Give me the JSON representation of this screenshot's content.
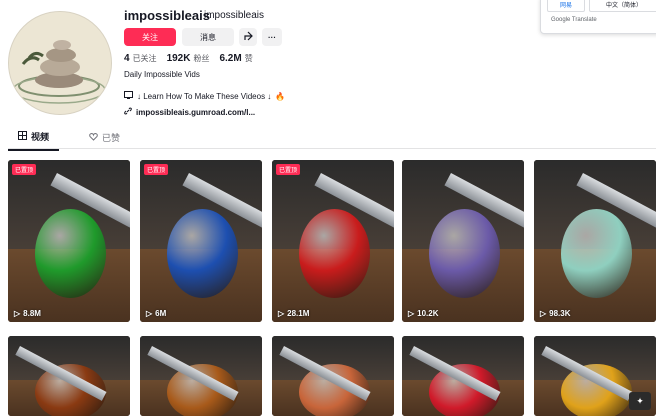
{
  "profile": {
    "username": "impossibleais",
    "nickname": "impossibleais",
    "follow_label": "关注",
    "message_label": "消息",
    "following_count": "4",
    "following_label": "已关注",
    "followers_count": "192K",
    "followers_label": "粉丝",
    "likes_count": "6.2M",
    "likes_label": "赞",
    "bio": "Daily Impossible Vids",
    "bio_line2": "↓ Learn How To Make These Videos ↓",
    "link": "impossibleais.gumroad.com/l..."
  },
  "tabs": [
    {
      "label": "视频",
      "icon": "grid-icon",
      "active": true
    },
    {
      "label": "已赞",
      "icon": "heart-outline-icon",
      "active": false
    }
  ],
  "videos": [
    {
      "views": "8.8M",
      "badge": "已置顶",
      "subject": "green jelly",
      "color": "#1f9a2b"
    },
    {
      "views": "6M",
      "badge": "已置顶",
      "subject": "blue berry",
      "color": "#1d4fb0"
    },
    {
      "views": "28.1M",
      "badge": "已置顶",
      "subject": "glass strawberry",
      "color": "#c91c1c"
    },
    {
      "views": "10.2K",
      "badge": "",
      "subject": "glass orb",
      "color": "#6b5aa8"
    },
    {
      "views": "98.3K",
      "badge": "",
      "subject": "glass sphere",
      "color": "#8fcfbf"
    },
    {
      "views": "",
      "badge": "",
      "subject": "glazed dessert",
      "color": "#8a3a12"
    },
    {
      "views": "",
      "badge": "",
      "subject": "glass burger",
      "color": "#a85a1a"
    },
    {
      "views": "",
      "badge": "",
      "subject": "glass egg",
      "color": "#c8653a"
    },
    {
      "views": "",
      "badge": "",
      "subject": "red fruit",
      "color": "#d01a2a"
    },
    {
      "views": "",
      "badge": "",
      "subject": "yellow fruit",
      "color": "#e0a21a"
    }
  ],
  "translate_popup": {
    "left_btn": "网易",
    "right_btn": "中文（简体）",
    "footer": "Google Translate"
  },
  "colors": {
    "accent": "#fe2c55",
    "text": "#161823"
  }
}
